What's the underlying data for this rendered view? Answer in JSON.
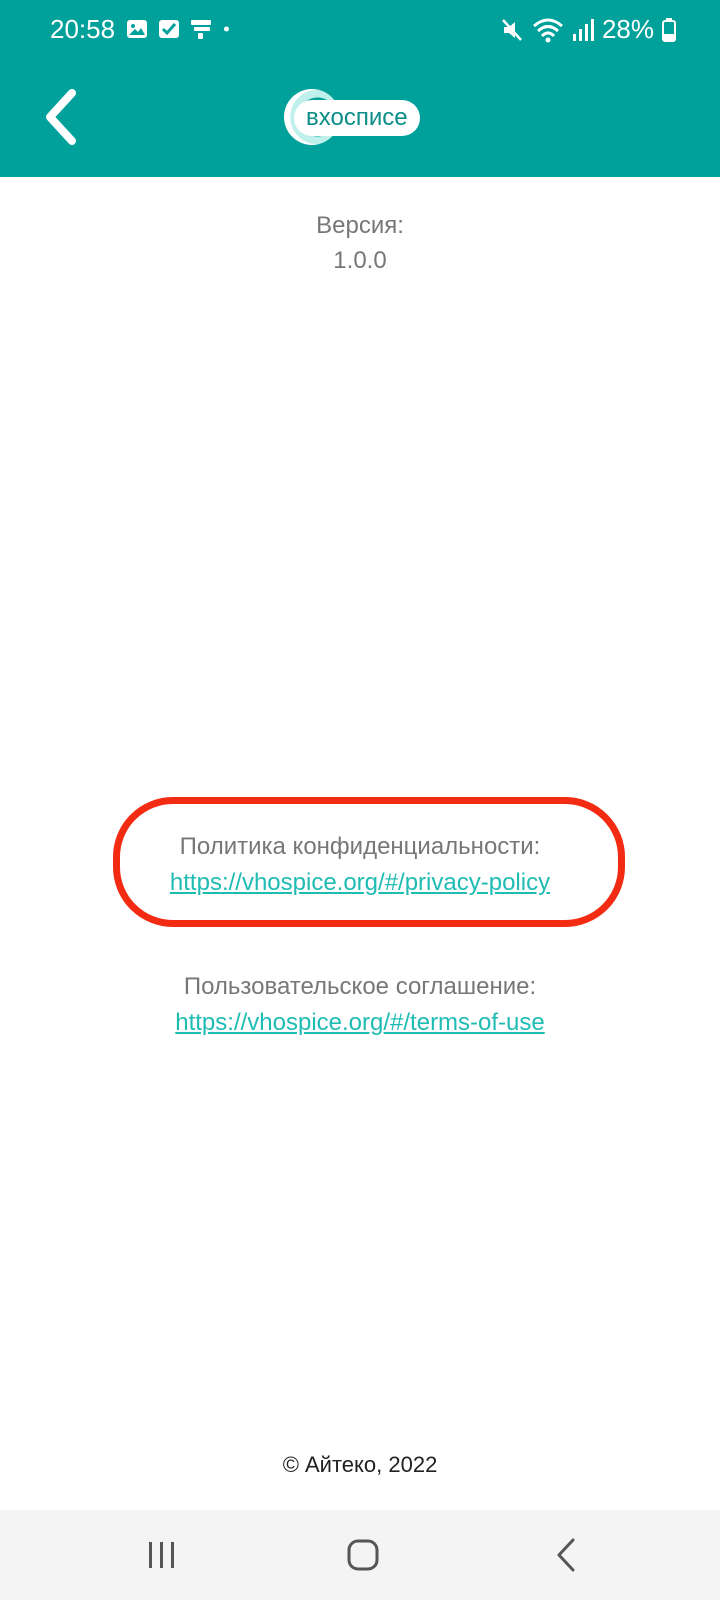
{
  "status_bar": {
    "time": "20:58",
    "left_icons": [
      "gallery-icon",
      "checkbox-icon",
      "sim-toolkit-icon",
      "dot-icon"
    ],
    "right_icons": [
      "mute-icon",
      "wifi-icon",
      "signal-icon"
    ],
    "battery": "28%"
  },
  "header": {
    "logo_text": "вхосписе",
    "background_color": "#00a19b"
  },
  "about": {
    "version_label": "Версия:",
    "version_value": "1.0.0",
    "privacy_label": "Политика конфиденциальности:",
    "privacy_link": "https://vhospice.org/#/privacy-policy",
    "terms_label": "Пользовательское соглашение:",
    "terms_link": "https://vhospice.org/#/terms-of-use",
    "copyright": "© Айтеко, 2022",
    "link_color": "#1fbcb4",
    "highlight_color": "#f22b12"
  },
  "navbar": {
    "buttons": [
      "recent-apps-icon",
      "home-icon",
      "back-icon"
    ]
  }
}
